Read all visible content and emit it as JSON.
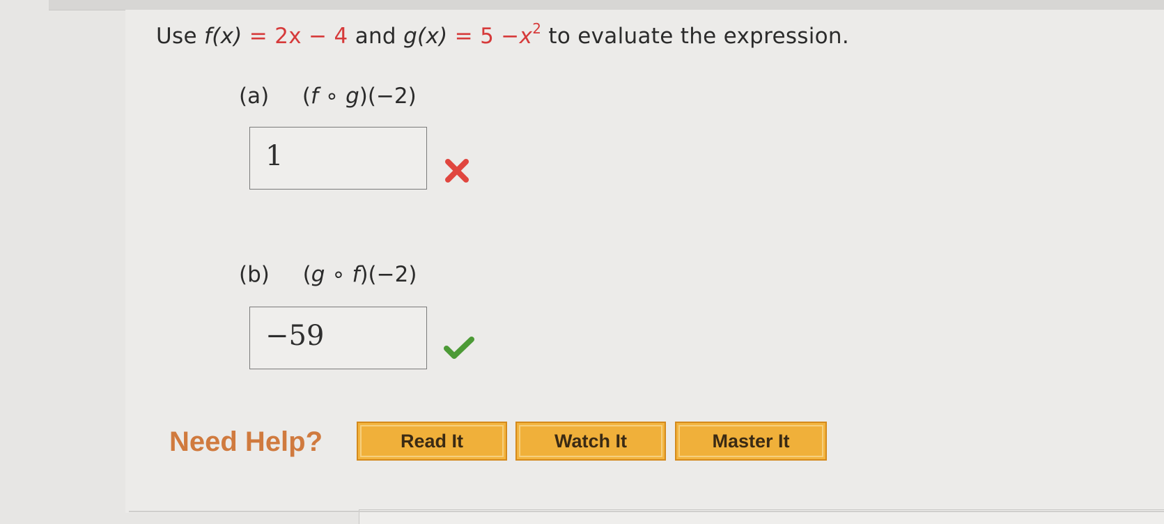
{
  "question": {
    "use": "Use",
    "f_def_lhs": "f(x)",
    "f_def_eq": "=",
    "f_def_rhs_coef": "2x",
    "f_def_minus": "−",
    "f_def_const": "4",
    "and": "and",
    "g_def_lhs": "g(x)",
    "g_def_eq": "=",
    "g_def_const": "5",
    "g_def_minus": "−",
    "g_def_var": "x",
    "g_def_exp": "2",
    "tail": "to evaluate the expression."
  },
  "part_a": {
    "label": "(a)",
    "expr_open": "(",
    "expr_f": "f",
    "expr_circ": "∘",
    "expr_g": "g",
    "expr_close": ")(−2)",
    "answer": "1",
    "status": "incorrect",
    "status_color": "#e0463f"
  },
  "part_b": {
    "label": "(b)",
    "expr_open": "(",
    "expr_g": "g",
    "expr_circ": "∘",
    "expr_f": "f",
    "expr_close": ")(−2)",
    "answer": "−59",
    "status": "correct",
    "status_color": "#4c9a36"
  },
  "help": {
    "title": "Need Help?",
    "buttons": [
      "Read It",
      "Watch It",
      "Master It"
    ]
  }
}
